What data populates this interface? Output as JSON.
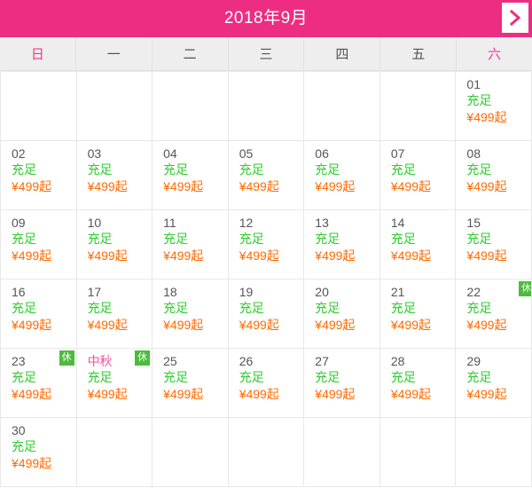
{
  "header": {
    "title": "2018年9月",
    "next_icon": "chevron-right-icon",
    "bar_color": "#ec2d82",
    "title_color": "#ffffff"
  },
  "weekdays": [
    {
      "label": "日",
      "accent": true
    },
    {
      "label": "一",
      "accent": false
    },
    {
      "label": "二",
      "accent": false
    },
    {
      "label": "三",
      "accent": false
    },
    {
      "label": "四",
      "accent": false
    },
    {
      "label": "五",
      "accent": false
    },
    {
      "label": "六",
      "accent": true
    }
  ],
  "colors": {
    "day_number": "#555555",
    "stock_text": "#2ecc2e",
    "price_text": "#ff6a00",
    "festival_text": "#f5509b",
    "badge_bg": "#4cbb3c",
    "weekday_accent": "#f5348c",
    "grid_line": "#e8e8e8",
    "weekday_bg": "#eeeeee"
  },
  "labels": {
    "stock": "充足",
    "price": "¥499起",
    "rest_badge": "休",
    "festival_mid_autumn": "中秋"
  },
  "cells": [
    {
      "type": "empty"
    },
    {
      "type": "empty"
    },
    {
      "type": "empty"
    },
    {
      "type": "empty"
    },
    {
      "type": "empty"
    },
    {
      "type": "empty"
    },
    {
      "type": "day",
      "day": "01",
      "stock": "充足",
      "price": "¥499起"
    },
    {
      "type": "day",
      "day": "02",
      "stock": "充足",
      "price": "¥499起"
    },
    {
      "type": "day",
      "day": "03",
      "stock": "充足",
      "price": "¥499起"
    },
    {
      "type": "day",
      "day": "04",
      "stock": "充足",
      "price": "¥499起"
    },
    {
      "type": "day",
      "day": "05",
      "stock": "充足",
      "price": "¥499起"
    },
    {
      "type": "day",
      "day": "06",
      "stock": "充足",
      "price": "¥499起"
    },
    {
      "type": "day",
      "day": "07",
      "stock": "充足",
      "price": "¥499起"
    },
    {
      "type": "day",
      "day": "08",
      "stock": "充足",
      "price": "¥499起"
    },
    {
      "type": "day",
      "day": "09",
      "stock": "充足",
      "price": "¥499起"
    },
    {
      "type": "day",
      "day": "10",
      "stock": "充足",
      "price": "¥499起"
    },
    {
      "type": "day",
      "day": "11",
      "stock": "充足",
      "price": "¥499起"
    },
    {
      "type": "day",
      "day": "12",
      "stock": "充足",
      "price": "¥499起"
    },
    {
      "type": "day",
      "day": "13",
      "stock": "充足",
      "price": "¥499起"
    },
    {
      "type": "day",
      "day": "14",
      "stock": "充足",
      "price": "¥499起"
    },
    {
      "type": "day",
      "day": "15",
      "stock": "充足",
      "price": "¥499起"
    },
    {
      "type": "day",
      "day": "16",
      "stock": "充足",
      "price": "¥499起"
    },
    {
      "type": "day",
      "day": "17",
      "stock": "充足",
      "price": "¥499起"
    },
    {
      "type": "day",
      "day": "18",
      "stock": "充足",
      "price": "¥499起"
    },
    {
      "type": "day",
      "day": "19",
      "stock": "充足",
      "price": "¥499起"
    },
    {
      "type": "day",
      "day": "20",
      "stock": "充足",
      "price": "¥499起"
    },
    {
      "type": "day",
      "day": "21",
      "stock": "充足",
      "price": "¥499起"
    },
    {
      "type": "day",
      "day": "22",
      "stock": "充足",
      "price": "¥499起",
      "badge": "休",
      "badge_clipped": true
    },
    {
      "type": "day",
      "day": "23",
      "stock": "充足",
      "price": "¥499起",
      "badge": "休"
    },
    {
      "type": "day",
      "day": "中秋",
      "festival": true,
      "stock": "充足",
      "price": "¥499起",
      "badge": "休"
    },
    {
      "type": "day",
      "day": "25",
      "stock": "充足",
      "price": "¥499起"
    },
    {
      "type": "day",
      "day": "26",
      "stock": "充足",
      "price": "¥499起"
    },
    {
      "type": "day",
      "day": "27",
      "stock": "充足",
      "price": "¥499起"
    },
    {
      "type": "day",
      "day": "28",
      "stock": "充足",
      "price": "¥499起"
    },
    {
      "type": "day",
      "day": "29",
      "stock": "充足",
      "price": "¥499起"
    },
    {
      "type": "day",
      "day": "30",
      "stock": "充足",
      "price": "¥499起"
    },
    {
      "type": "empty"
    },
    {
      "type": "empty"
    },
    {
      "type": "empty"
    },
    {
      "type": "empty"
    },
    {
      "type": "empty"
    },
    {
      "type": "empty"
    }
  ]
}
